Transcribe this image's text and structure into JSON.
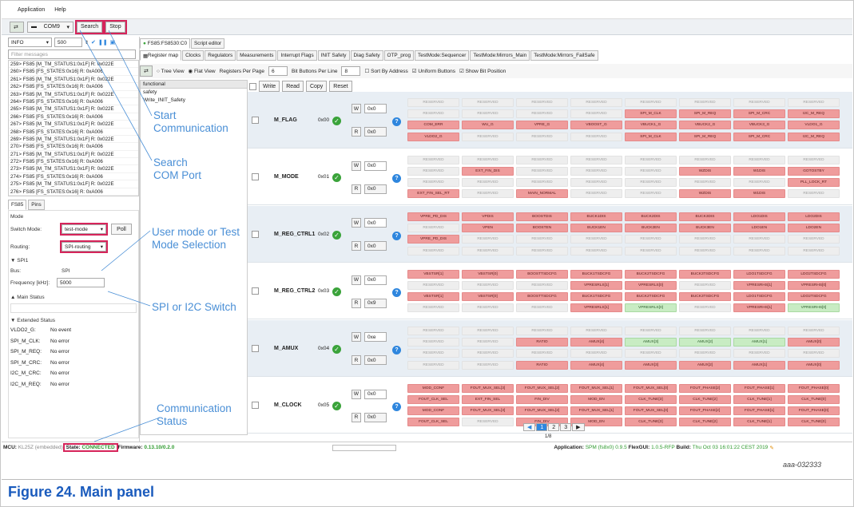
{
  "menu": [
    "Application",
    "Help"
  ],
  "toolbar": {
    "port": "COM9",
    "search": "Search",
    "stop": "Stop"
  },
  "left": {
    "level": "INFO",
    "count": "500",
    "filter_placeholder": "Filter messages",
    "log": [
      "259> FS85 [M_TM_STATUS1:0x1F] R: 0x022E",
      "260> FS85 [FS_STATES:0x16] R: 0xA006",
      "261> FS85 [M_TM_STATUS1:0x1F] R: 0x022E",
      "262> FS85 [FS_STATES:0x16] R: 0xA006",
      "263> FS85 [M_TM_STATUS1:0x1F] R: 0x022E",
      "264> FS85 [FS_STATES:0x16] R: 0xA006",
      "265> FS85 [M_TM_STATUS1:0x1F] R: 0x022E",
      "266> FS85 [FS_STATES:0x16] R: 0xA006",
      "267> FS85 [M_TM_STATUS1:0x1F] R: 0x022E",
      "268> FS85 [FS_STATES:0x16] R: 0xA006",
      "269> FS85 [M_TM_STATUS1:0x1F] R: 0x022E",
      "270> FS85 [FS_STATES:0x16] R: 0xA006",
      "271> FS85 [M_TM_STATUS1:0x1F] R: 0x022E",
      "272> FS85 [FS_STATES:0x16] R: 0xA006",
      "273> FS85 [M_TM_STATUS1:0x1F] R: 0x022E",
      "274> FS85 [FS_STATES:0x16] R: 0xA006",
      "275> FS85 [M_TM_STATUS1:0x1F] R: 0x022E",
      "276> FS85 [FS_STATES:0x16] R: 0xA006"
    ],
    "tabs": [
      "FS85",
      "Pins"
    ],
    "mode_label": "Mode",
    "switch_mode_label": "Switch Mode:",
    "switch_mode": "test-mode",
    "poll": "Poll",
    "routing_label": "Routing:",
    "routing": "SPI-routing",
    "spi_section": "SPI1",
    "bus_label": "Bus:",
    "bus": "SPI",
    "freq_label": "Frequency [kHz]:",
    "freq": "5000",
    "main_status": "Main Status",
    "ext_status": "Extended Status",
    "ext": [
      {
        "k": "VLDO2_G:",
        "v": "No event"
      },
      {
        "k": "SPI_M_CLK:",
        "v": "No error"
      },
      {
        "k": "SPI_M_REQ:",
        "v": "No error"
      },
      {
        "k": "SPI_M_CRC:",
        "v": "No error"
      },
      {
        "k": "I2C_M_CRC:",
        "v": "No error"
      },
      {
        "k": "I2C_M_REQ:",
        "v": "No error"
      }
    ]
  },
  "device_tab": "FS85:FS8530:C0",
  "script_tab": "Script editor",
  "subtabs": [
    "Register map",
    "Clocks",
    "Regulators",
    "Measurements",
    "Interrupt Flags",
    "INIT Safety",
    "Diag Safety",
    "OTP_prog",
    "TestMode:Sequencer",
    "TestMode:Mirrors_Main",
    "TestMode:Mirrors_FailSafe"
  ],
  "opts": {
    "tree": "Tree View",
    "flat": "Flat View",
    "rpp_label": "Registers Per Page",
    "rpp": "6",
    "bpl_label": "Bit Buttons Per Line",
    "bpl": "8",
    "sort": "Sort By Address",
    "uniform": "Uniform Buttons",
    "showbit": "Show Bit Position"
  },
  "actions": [
    "Write",
    "Read",
    "Copy",
    "Reset"
  ],
  "tree": [
    "functional",
    "safety",
    "Write_INIT_Safety"
  ],
  "registers": [
    {
      "name": "M_FLAG",
      "addr": "0x00",
      "w": "0x0",
      "r": "0x0",
      "rows": [
        [
          [
            "RESERVED",
            "r"
          ],
          [
            "RESERVED",
            "r"
          ],
          [
            "RESERVED",
            "r"
          ],
          [
            "RESERVED",
            "r"
          ],
          [
            "RESERVED",
            "r"
          ],
          [
            "RESERVED",
            "r"
          ],
          [
            "RESERVED",
            "r"
          ],
          [
            "RESERVED",
            "r"
          ]
        ],
        [
          [
            "RESERVED",
            "r"
          ],
          [
            "RESERVED",
            "r"
          ],
          [
            "RESERVED",
            "r"
          ],
          [
            "RESERVED",
            "r"
          ],
          [
            "SPI_M_CLK",
            "x"
          ],
          [
            "SPI_M_REQ",
            "x"
          ],
          [
            "SPI_M_CRC",
            "x"
          ],
          [
            "I2C_M_REQ",
            "x"
          ]
        ],
        [
          [
            "COM_ERR",
            "x"
          ],
          [
            "WU_G",
            "x"
          ],
          [
            "VPRE_G",
            "x"
          ],
          [
            "VBOOST_G",
            "x"
          ],
          [
            "VBUCK1_G",
            "x"
          ],
          [
            "VBUCK2_G",
            "x"
          ],
          [
            "VBUCK3_G",
            "x"
          ],
          [
            "VLDO1_G",
            "x"
          ]
        ],
        [
          [
            "VLDO2_G",
            "x"
          ],
          [
            "RESERVED",
            "r"
          ],
          [
            "RESERVED",
            "r"
          ],
          [
            "RESERVED",
            "r"
          ],
          [
            "SPI_M_CLK",
            "x"
          ],
          [
            "SPI_M_REQ",
            "x"
          ],
          [
            "SPI_M_CRC",
            "x"
          ],
          [
            "I2C_M_REQ",
            "x"
          ]
        ]
      ]
    },
    {
      "name": "M_MODE",
      "addr": "0x01",
      "w": "0x0",
      "r": "0x0",
      "rows": [
        [
          [
            "RESERVED",
            "r"
          ],
          [
            "RESERVED",
            "r"
          ],
          [
            "RESERVED",
            "r"
          ],
          [
            "RESERVED",
            "r"
          ],
          [
            "RESERVED",
            "r"
          ],
          [
            "RESERVED",
            "r"
          ],
          [
            "RESERVED",
            "r"
          ],
          [
            "RESERVED",
            "r"
          ]
        ],
        [
          [
            "RESERVED",
            "r"
          ],
          [
            "EXT_FIN_DIS",
            "x"
          ],
          [
            "RESERVED",
            "r"
          ],
          [
            "RESERVED",
            "r"
          ],
          [
            "RESERVED",
            "r"
          ],
          [
            "WZDIS",
            "x"
          ],
          [
            "W1DIS",
            "x"
          ],
          [
            "GOTOSTBY",
            "x"
          ]
        ],
        [
          [
            "RESERVED",
            "r"
          ],
          [
            "RESERVED",
            "r"
          ],
          [
            "RESERVED",
            "r"
          ],
          [
            "RESERVED",
            "r"
          ],
          [
            "RESERVED",
            "r"
          ],
          [
            "RESERVED",
            "r"
          ],
          [
            "RESERVED",
            "r"
          ],
          [
            "PLL_LOCK_RT",
            "x"
          ]
        ],
        [
          [
            "EXT_FIN_SEL_RT",
            "x"
          ],
          [
            "RESERVED",
            "r"
          ],
          [
            "MAIN_NORMAL",
            "x"
          ],
          [
            "RESERVED",
            "r"
          ],
          [
            "RESERVED",
            "r"
          ],
          [
            "WZDIS",
            "x"
          ],
          [
            "W1DIS",
            "x"
          ],
          [
            "RESERVED",
            "r"
          ]
        ]
      ]
    },
    {
      "name": "M_REG_CTRL1",
      "addr": "0x02",
      "w": "0x0",
      "r": "0x0",
      "rows": [
        [
          [
            "VPRE_PD_DIS",
            "x"
          ],
          [
            "VPDIS",
            "x"
          ],
          [
            "BOOSTDIS",
            "x"
          ],
          [
            "BUCK1DIS",
            "x"
          ],
          [
            "BUCK2DIS",
            "x"
          ],
          [
            "BUCK3DIS",
            "x"
          ],
          [
            "LDO1DIS",
            "x"
          ],
          [
            "LDO2DIS",
            "x"
          ]
        ],
        [
          [
            "RESERVED",
            "r"
          ],
          [
            "VPEN",
            "x"
          ],
          [
            "BOOSTEN",
            "x"
          ],
          [
            "BUCK1EN",
            "x"
          ],
          [
            "BUCK2EN",
            "x"
          ],
          [
            "BUCK3EN",
            "x"
          ],
          [
            "LDO1EN",
            "x"
          ],
          [
            "LDO2EN",
            "x"
          ]
        ],
        [
          [
            "VPRE_PD_DIS",
            "x"
          ],
          [
            "RESERVED",
            "r"
          ],
          [
            "RESERVED",
            "r"
          ],
          [
            "RESERVED",
            "r"
          ],
          [
            "RESERVED",
            "r"
          ],
          [
            "RESERVED",
            "r"
          ],
          [
            "RESERVED",
            "r"
          ],
          [
            "RESERVED",
            "r"
          ]
        ],
        [
          [
            "RESERVED",
            "r"
          ],
          [
            "RESERVED",
            "r"
          ],
          [
            "RESERVED",
            "r"
          ],
          [
            "RESERVED",
            "r"
          ],
          [
            "RESERVED",
            "r"
          ],
          [
            "RESERVED",
            "r"
          ],
          [
            "RESERVED",
            "r"
          ],
          [
            "RESERVED",
            "r"
          ]
        ]
      ]
    },
    {
      "name": "M_REG_CTRL2",
      "addr": "0x03",
      "w": "0x0",
      "r": "0x9",
      "rows": [
        [
          [
            "VBSTSR[1]",
            "x"
          ],
          [
            "VBSTSR[0]",
            "x"
          ],
          [
            "BOOSTTSDCFG",
            "x"
          ],
          [
            "BUCK1TSDCFG",
            "x"
          ],
          [
            "BUCK2TSDCFG",
            "x"
          ],
          [
            "BUCK3TSDCFG",
            "x"
          ],
          [
            "LDO1TSDCFG",
            "x"
          ],
          [
            "LDO2TSDCFG",
            "x"
          ]
        ],
        [
          [
            "RESERVED",
            "r"
          ],
          [
            "RESERVED",
            "r"
          ],
          [
            "RESERVED",
            "r"
          ],
          [
            "VPRESRLS[1]",
            "x"
          ],
          [
            "VPRESRLS[0]",
            "x"
          ],
          [
            "RESERVED",
            "r"
          ],
          [
            "VPRESRHS[1]",
            "x"
          ],
          [
            "VPRESRHS[0]",
            "x"
          ]
        ],
        [
          [
            "VBSTSR[1]",
            "x"
          ],
          [
            "VBSTSR[0]",
            "x"
          ],
          [
            "BOOSTTSDCFG",
            "x"
          ],
          [
            "BUCK1TSDCFG",
            "x"
          ],
          [
            "BUCK2TSDCFG",
            "x"
          ],
          [
            "BUCK3TSDCFG",
            "x"
          ],
          [
            "LDO1TSDCFG",
            "x"
          ],
          [
            "LDO2TSDCFG",
            "x"
          ]
        ],
        [
          [
            "RESERVED",
            "r"
          ],
          [
            "RESERVED",
            "r"
          ],
          [
            "RESERVED",
            "r"
          ],
          [
            "VPRESRLS[1]",
            "x"
          ],
          [
            "VPRESRLS[0]",
            "g"
          ],
          [
            "RESERVED",
            "r"
          ],
          [
            "VPRESRHS[1]",
            "x"
          ],
          [
            "VPRESRHS[0]",
            "g"
          ]
        ]
      ]
    },
    {
      "name": "M_AMUX",
      "addr": "0x04",
      "w": "0xe",
      "r": "0x0",
      "rows": [
        [
          [
            "RESERVED",
            "r"
          ],
          [
            "RESERVED",
            "r"
          ],
          [
            "RESERVED",
            "r"
          ],
          [
            "RESERVED",
            "r"
          ],
          [
            "RESERVED",
            "r"
          ],
          [
            "RESERVED",
            "r"
          ],
          [
            "RESERVED",
            "r"
          ],
          [
            "RESERVED",
            "r"
          ]
        ],
        [
          [
            "RESERVED",
            "r"
          ],
          [
            "RESERVED",
            "r"
          ],
          [
            "RATIO",
            "x"
          ],
          [
            "AMUX[4]",
            "x"
          ],
          [
            "AMUX[3]",
            "g"
          ],
          [
            "AMUX[2]",
            "g"
          ],
          [
            "AMUX[1]",
            "g"
          ],
          [
            "AMUX[0]",
            "x"
          ]
        ],
        [
          [
            "RESERVED",
            "r"
          ],
          [
            "RESERVED",
            "r"
          ],
          [
            "RESERVED",
            "r"
          ],
          [
            "RESERVED",
            "r"
          ],
          [
            "RESERVED",
            "r"
          ],
          [
            "RESERVED",
            "r"
          ],
          [
            "RESERVED",
            "r"
          ],
          [
            "RESERVED",
            "r"
          ]
        ],
        [
          [
            "RESERVED",
            "r"
          ],
          [
            "RESERVED",
            "r"
          ],
          [
            "RATIO",
            "x"
          ],
          [
            "AMUX[4]",
            "x"
          ],
          [
            "AMUX[3]",
            "x"
          ],
          [
            "AMUX[2]",
            "x"
          ],
          [
            "AMUX[1]",
            "x"
          ],
          [
            "AMUX[0]",
            "x"
          ]
        ]
      ]
    },
    {
      "name": "M_CLOCK",
      "addr": "0x05",
      "w": "0x0",
      "r": "0x0",
      "rows": [
        [
          [
            "MOD_CONF",
            "x"
          ],
          [
            "FOUT_MUX_SEL[3]",
            "x"
          ],
          [
            "FOUT_MUX_SEL[2]",
            "x"
          ],
          [
            "FOUT_MUX_SEL[1]",
            "x"
          ],
          [
            "FOUT_MUX_SEL[0]",
            "x"
          ],
          [
            "FOUT_PHASE[2]",
            "x"
          ],
          [
            "FOUT_PHASE[1]",
            "x"
          ],
          [
            "FOUT_PHASE[0]",
            "x"
          ]
        ],
        [
          [
            "FOUT_CLK_SEL",
            "x"
          ],
          [
            "EXT_FIN_SEL",
            "x"
          ],
          [
            "FIN_DIV",
            "x"
          ],
          [
            "MOD_EN",
            "x"
          ],
          [
            "CLK_TUNE[3]",
            "x"
          ],
          [
            "CLK_TUNE[2]",
            "x"
          ],
          [
            "CLK_TUNE[1]",
            "x"
          ],
          [
            "CLK_TUNE[0]",
            "x"
          ]
        ],
        [
          [
            "MOD_CONF",
            "x"
          ],
          [
            "FOUT_MUX_SEL[3]",
            "x"
          ],
          [
            "FOUT_MUX_SEL[2]",
            "x"
          ],
          [
            "FOUT_MUX_SEL[1]",
            "x"
          ],
          [
            "FOUT_MUX_SEL[0]",
            "x"
          ],
          [
            "FOUT_PHASE[2]",
            "x"
          ],
          [
            "FOUT_PHASE[1]",
            "x"
          ],
          [
            "FOUT_PHASE[0]",
            "x"
          ]
        ],
        [
          [
            "FOUT_CLK_SEL",
            "x"
          ],
          [
            "RESERVED",
            "r"
          ],
          [
            "FIN_DIV",
            "x"
          ],
          [
            "MOD_EN",
            "x"
          ],
          [
            "CLK_TUNE[3]",
            "x"
          ],
          [
            "CLK_TUNE[2]",
            "x"
          ],
          [
            "CLK_TUNE[1]",
            "x"
          ],
          [
            "CLK_TUNE[0]",
            "x"
          ]
        ]
      ]
    }
  ],
  "pager": {
    "pages": [
      "1",
      "2",
      "3"
    ],
    "info": "1/8"
  },
  "status": {
    "mcu_label": "MCU:",
    "mcu": "KL25Z (embedded)",
    "state_label": "State:",
    "state": "CONNECTED",
    "fw_label": "Firmware:",
    "fw": "0.13.10/0.2.0",
    "app_label": "Application:",
    "app": "SPM (fs8x0) 0.9.5",
    "gui_label": "FlexGUI:",
    "gui": "1.0.5-RFP",
    "build_label": "Build:",
    "build": "Thu Oct 03 16:01:22 CEST 2019"
  },
  "annotations": {
    "start": "Start\nCommunication",
    "search": "Search\nCOM Port",
    "mode": "User mode or Test\nMode Selection",
    "switch": "SPI or I2C Switch",
    "status": "Communication\nStatus"
  },
  "figure_id": "aaa-032333",
  "caption": "Figure 24.  Main panel",
  "colors": {
    "reserved": "#eeeeee",
    "set": "#ef9c9c",
    "ok": "#c8ecc3",
    "highlight": "#d6245a",
    "annotation": "#4a8fd6"
  }
}
